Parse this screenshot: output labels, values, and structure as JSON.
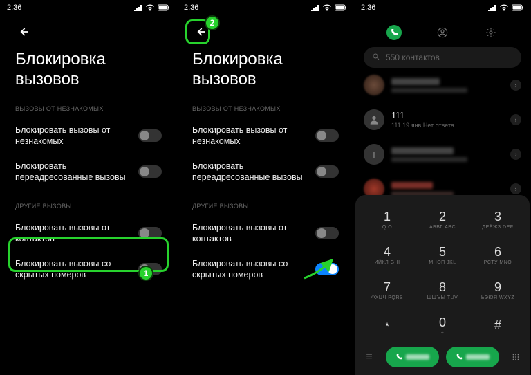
{
  "status": {
    "time": "2:36"
  },
  "screen1": {
    "title": "Блокировка вызовов",
    "section1": "ВЫЗОВЫ ОТ НЕЗНАКОМЫХ",
    "s1_r1": "Блокировать вызовы от незнакомых",
    "s1_r2": "Блокировать переадресованные вызовы",
    "section2": "ДРУГИЕ ВЫЗОВЫ",
    "s2_r1": "Блокировать вызовы от контактов",
    "s2_r2": "Блокировать вызовы со скрытых номеров",
    "badge1": "1"
  },
  "screen2": {
    "title": "Блокировка вызовов",
    "section1": "ВЫЗОВЫ ОТ НЕЗНАКОМЫХ",
    "s1_r1": "Блокировать вызовы от незнакомых",
    "s1_r2": "Блокировать переадресованные вызовы",
    "section2": "ДРУГИЕ ВЫЗОВЫ",
    "s2_r1": "Блокировать вызовы от контактов",
    "s2_r2": "Блокировать вызовы со скрытых номеров",
    "badge2": "2"
  },
  "screen3": {
    "search_placeholder": "550 контактов",
    "contact2_name": "111",
    "contact2_sub": "111 19 янв Нет ответа",
    "contact3_letter": "T",
    "keys": [
      {
        "main": "1",
        "sub": "Q.O"
      },
      {
        "main": "2",
        "sub": "АБВГ ABC"
      },
      {
        "main": "3",
        "sub": "ДЕЁЖЗ DEF"
      },
      {
        "main": "4",
        "sub": "ИЙКЛ GHI"
      },
      {
        "main": "5",
        "sub": "МНОП JKL"
      },
      {
        "main": "6",
        "sub": "РСТУ MNO"
      },
      {
        "main": "7",
        "sub": "ФХЦЧ PQRS"
      },
      {
        "main": "8",
        "sub": "ШЩЪЫ TUV"
      },
      {
        "main": "9",
        "sub": "ЬЭЮЯ WXYZ"
      },
      {
        "main": "﹡",
        "sub": ""
      },
      {
        "main": "0",
        "sub": "+"
      },
      {
        "main": "#",
        "sub": ""
      }
    ]
  }
}
